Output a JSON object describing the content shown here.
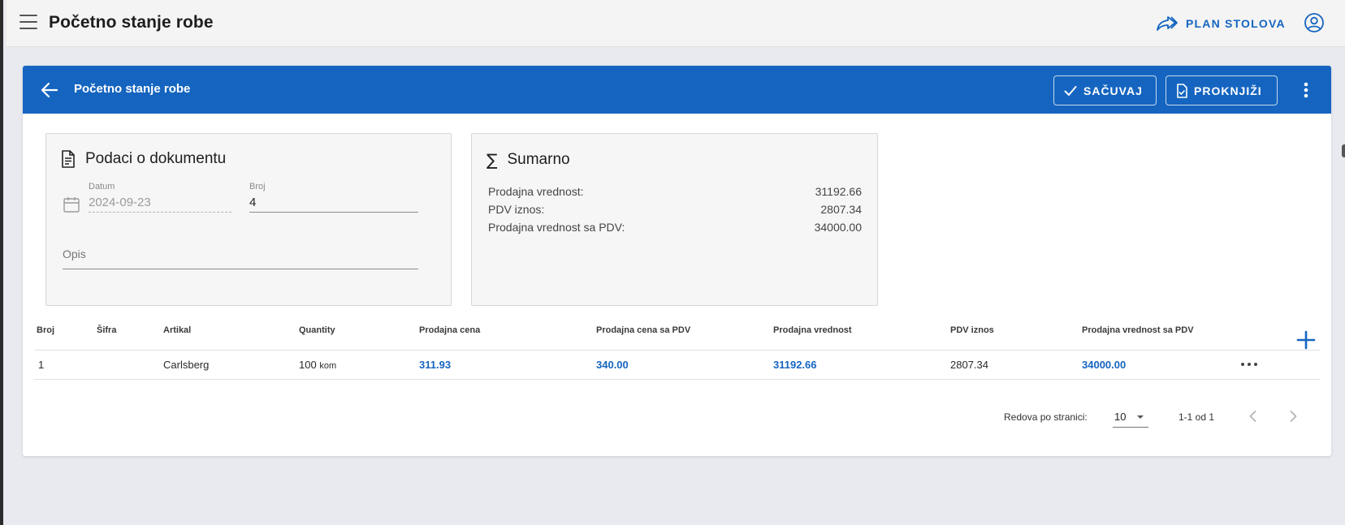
{
  "app": {
    "title": "Početno stanje robe",
    "plan_label": "PLAN STOLOVA"
  },
  "card": {
    "title": "Početno stanje robe",
    "save_label": "SAČUVAJ",
    "post_label": "PROKNJIŽI"
  },
  "doc_panel": {
    "title": "Podaci o dokumentu",
    "date_label": "Datum",
    "date_value": "2024-09-23",
    "number_label": "Broj",
    "number_value": "4",
    "desc_label": "Opis"
  },
  "summary_panel": {
    "title": "Sumarno",
    "rows": [
      {
        "label": "Prodajna vrednost:",
        "value": "31192.66"
      },
      {
        "label": "PDV iznos:",
        "value": "2807.34"
      },
      {
        "label": "Prodajna vrednost sa PDV:",
        "value": "34000.00"
      }
    ]
  },
  "table": {
    "headers": [
      "Broj",
      "Šifra",
      "Artikal",
      "Quantity",
      "Prodajna cena",
      "Prodajna cena sa PDV",
      "Prodajna vrednost",
      "PDV iznos",
      "Prodajna vrednost sa PDV"
    ],
    "rows": [
      {
        "broj": "1",
        "sifra": "",
        "artikal": "Carlsberg",
        "quantity": "100",
        "unit": "kom",
        "prodajna_cena": "311.93",
        "prodajna_cena_pdv": "340.00",
        "prodajna_vrednost": "31192.66",
        "pdv_iznos": "2807.34",
        "prodajna_vrednost_pdv": "34000.00"
      }
    ]
  },
  "pagination": {
    "rows_label": "Redova po stranici:",
    "rows_per_page": "10",
    "range": "1-1 od 1"
  },
  "colors": {
    "primary": "#1565c0",
    "background": "#e8eaef"
  }
}
